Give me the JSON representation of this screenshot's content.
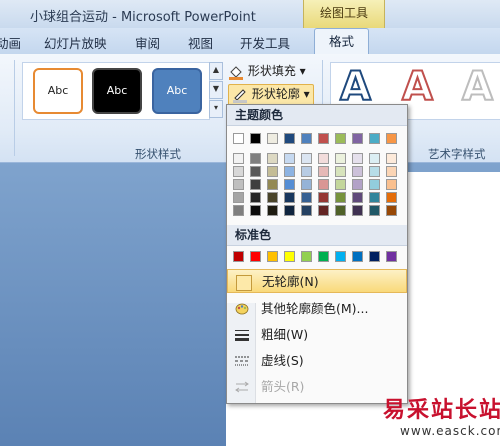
{
  "titlebar": {
    "title": "小球组合运动 - Microsoft PowerPoint",
    "context_tab": "绘图工具"
  },
  "tabs": [
    {
      "label": "动画"
    },
    {
      "label": "幻灯片放映"
    },
    {
      "label": "审阅"
    },
    {
      "label": "视图"
    },
    {
      "label": "开发工具"
    },
    {
      "label": "格式"
    }
  ],
  "ribbon": {
    "shape_styles": {
      "sample_text": "Abc",
      "group_label": "形状样式"
    },
    "fill_label": "形状填充",
    "outline_label": "形状轮廓",
    "wordart_group_label": "艺术字样式",
    "wordart_letter": "A"
  },
  "dropdown": {
    "theme_colors_header": "主题颜色",
    "standard_colors_header": "标准色",
    "theme_colors": [
      "#ffffff",
      "#000000",
      "#eeece1",
      "#1f497d",
      "#4f81bd",
      "#c0504d",
      "#9bbb59",
      "#8064a2",
      "#4bacc6",
      "#f79646"
    ],
    "theme_shades": [
      [
        "#f2f2f2",
        "#7f7f7f",
        "#ddd9c3",
        "#c6d9f0",
        "#dbe5f1",
        "#f2dcdb",
        "#ebf1dd",
        "#e5e0ec",
        "#dbeef3",
        "#fdeada"
      ],
      [
        "#d8d8d8",
        "#595959",
        "#c4bd97",
        "#8db3e2",
        "#b8cce4",
        "#e5b9b7",
        "#d7e3bc",
        "#ccc1d9",
        "#b7dde8",
        "#fbd5b5"
      ],
      [
        "#bfbfbf",
        "#3f3f3f",
        "#938953",
        "#548dd4",
        "#95b3d7",
        "#d99694",
        "#c3d69b",
        "#b2a2c7",
        "#92cddc",
        "#fac08f"
      ],
      [
        "#a5a5a5",
        "#262626",
        "#494429",
        "#17365d",
        "#366092",
        "#953734",
        "#76923c",
        "#5f497a",
        "#31859b",
        "#e36c09"
      ],
      [
        "#7f7f7f",
        "#0c0c0c",
        "#1d1b10",
        "#0f243e",
        "#244061",
        "#632423",
        "#4f6128",
        "#3f3151",
        "#205867",
        "#974806"
      ]
    ],
    "standard_colors": [
      "#c00000",
      "#ff0000",
      "#ffc000",
      "#ffff00",
      "#92d050",
      "#00b050",
      "#00b0f0",
      "#0070c0",
      "#002060",
      "#7030a0"
    ],
    "items": {
      "no_outline": "无轮廓(N)",
      "more_colors": "其他轮廓颜色(M)...",
      "weight": "粗细(W)",
      "dashes": "虚线(S)",
      "arrows": "箭头(R)"
    }
  },
  "watermark": {
    "text": "易采站长站",
    "url": "www.easck.com"
  }
}
